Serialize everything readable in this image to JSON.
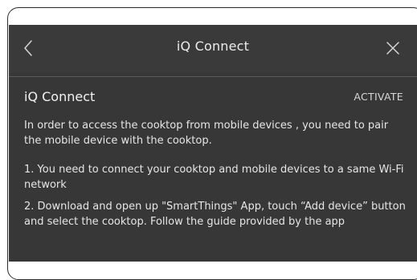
{
  "header": {
    "title": "iQ Connect",
    "back_icon": "chevron-left-icon",
    "close_icon": "close-icon"
  },
  "section": {
    "title": "iQ Connect",
    "action_label": "ACTIVATE"
  },
  "content": {
    "intro": "In order to access the cooktop from mobile devices , you need to pair the mobile device with the cooktop.",
    "step1": "1. You need to connect your cooktop and mobile devices to a same Wi-Fi network",
    "step2": "2. Download and open up \"SmartThings\" App, touch “Add device” button and select the cooktop. Follow the guide provided by the app"
  },
  "colors": {
    "background": "#373737",
    "text": "#e6e6e6",
    "frame": "#ffffff"
  }
}
